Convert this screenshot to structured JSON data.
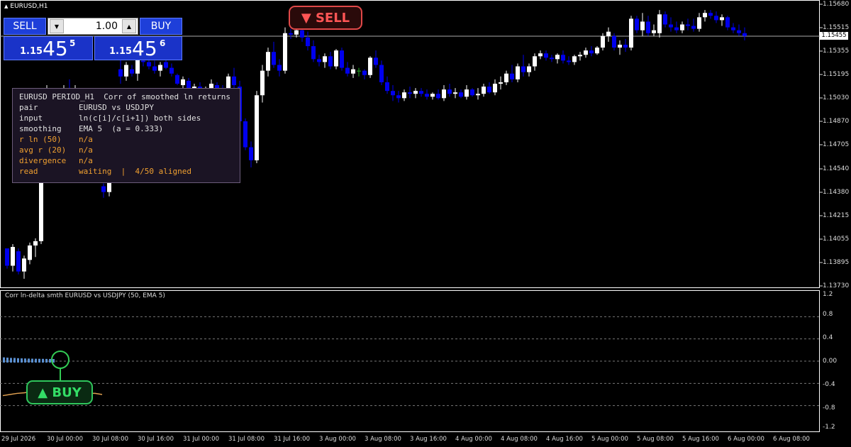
{
  "window": {
    "title": "EURUSD,H1"
  },
  "trade_panel": {
    "sell_label": "SELL",
    "buy_label": "BUY",
    "lot_value": "1.00",
    "bid": {
      "small": "1.15",
      "big": "45",
      "sup": "5"
    },
    "ask": {
      "small": "1.15",
      "big": "45",
      "sup": "6"
    }
  },
  "info_box": {
    "title": "EURUSD PERIOD_H1  Corr of smoothed ln returns",
    "rows": [
      {
        "label": "pair",
        "value": "EURUSD vs USDJPY",
        "tone": "w"
      },
      {
        "label": "input",
        "value": "ln(c[i]/c[i+1]) both sides",
        "tone": "w"
      },
      {
        "label": "smoothing",
        "value": "EMA 5  (a = 0.333)",
        "tone": "w"
      },
      {
        "label": "r ln (50)",
        "value": "n/a",
        "tone": "o"
      },
      {
        "label": "avg r (20)",
        "value": "n/a",
        "tone": "o"
      },
      {
        "label": "divergence",
        "value": "n/a",
        "tone": "o"
      },
      {
        "label": "read",
        "value": "waiting  |  4/50 aligned",
        "tone": "o"
      }
    ]
  },
  "signals": {
    "sell_label": "▼ SELL",
    "buy_label": "▲ BUY"
  },
  "subwindow": {
    "title": "Corr ln-delta smth EURUSD vs USDJPY (50, EMA 5)"
  },
  "price_axis": {
    "labels": [
      "1.15680",
      "1.15515",
      "1.15355",
      "1.15195",
      "1.15030",
      "1.14870",
      "1.14705",
      "1.14540",
      "1.14380",
      "1.14215",
      "1.14055",
      "1.13895",
      "1.13730"
    ],
    "current_price": "1.15455"
  },
  "sub_axis": {
    "labels": [
      "1.2",
      "0.8",
      "0.4",
      "0.00",
      "-0.4",
      "-0.8",
      "-1.2"
    ]
  },
  "time_axis": {
    "labels": [
      "29 Jul 2026",
      "30 Jul 00:00",
      "30 Jul 08:00",
      "30 Jul 16:00",
      "31 Jul 00:00",
      "31 Jul 08:00",
      "31 Jul 16:00",
      "3 Aug 00:00",
      "3 Aug 08:00",
      "3 Aug 16:00",
      "4 Aug 00:00",
      "4 Aug 08:00",
      "4 Aug 16:00",
      "5 Aug 00:00",
      "5 Aug 08:00",
      "5 Aug 16:00",
      "6 Aug 00:00",
      "6 Aug 08:00"
    ]
  },
  "colors": {
    "bull_candle": "#ffffff",
    "bear_candle": "#0000ee",
    "doji_candle": "#22aa22",
    "histogram": "#5a8fd0",
    "corr_line": "#e0a050",
    "buy_marker": "#33cc55"
  },
  "chart_data": {
    "type": "candlestick",
    "symbol": "EURUSD",
    "timeframe": "H1",
    "price_range": [
      1.1373,
      1.1568
    ],
    "candles": [
      [
        1.1399,
        1.1399,
        1.1385,
        1.1387
      ],
      [
        1.1387,
        1.1402,
        1.1383,
        1.14
      ],
      [
        1.1397,
        1.1399,
        1.1381,
        1.1383
      ],
      [
        1.1383,
        1.1394,
        1.1378,
        1.1392
      ],
      [
        1.1391,
        1.1403,
        1.1388,
        1.1401
      ],
      [
        1.1401,
        1.1406,
        1.1393,
        1.1404
      ],
      [
        1.1404,
        1.1474,
        1.1402,
        1.147
      ],
      [
        1.147,
        1.1512,
        1.1465,
        1.1505
      ],
      [
        1.1493,
        1.1506,
        1.149,
        1.1495
      ],
      [
        1.1495,
        1.15,
        1.1492,
        1.1498
      ],
      [
        1.1498,
        1.1512,
        1.1496,
        1.151
      ],
      [
        1.151,
        1.1516,
        1.1502,
        1.1505
      ],
      [
        1.1505,
        1.1512,
        1.15,
        1.1508
      ],
      [
        1.1503,
        1.1506,
        1.15,
        1.1501
      ],
      [
        1.1487,
        1.1488,
        1.1481,
        1.1482
      ],
      [
        1.1459,
        1.1461,
        1.1452,
        1.1453
      ],
      [
        1.1453,
        1.1461,
        1.1449,
        1.146
      ],
      [
        1.1442,
        1.1444,
        1.1434,
        1.1438
      ],
      [
        1.1438,
        1.146,
        1.1435,
        1.1456
      ],
      [
        1.1456,
        1.1508,
        1.1453,
        1.1505
      ],
      [
        1.1523,
        1.1534,
        1.1513,
        1.1518
      ],
      [
        1.1518,
        1.1528,
        1.1515,
        1.1526
      ],
      [
        1.1523,
        1.1526,
        1.1518,
        1.152
      ],
      [
        1.152,
        1.1531,
        1.1515,
        1.153
      ],
      [
        1.1529,
        1.1532,
        1.1525,
        1.1528
      ],
      [
        1.1528,
        1.1533,
        1.1523,
        1.1525
      ],
      [
        1.1525,
        1.1529,
        1.152,
        1.1522
      ],
      [
        1.1522,
        1.1528,
        1.1518,
        1.1526
      ],
      [
        1.1528,
        1.1531,
        1.1523,
        1.1524
      ],
      [
        1.1524,
        1.1527,
        1.1518,
        1.152
      ],
      [
        1.1519,
        1.152,
        1.1512,
        1.1513
      ],
      [
        1.1512,
        1.1518,
        1.1508,
        1.1516
      ],
      [
        1.1515,
        1.1517,
        1.1509,
        1.151
      ],
      [
        1.1509,
        1.1513,
        1.1504,
        1.1511
      ],
      [
        1.1511,
        1.1514,
        1.1505,
        1.1506
      ],
      [
        1.1506,
        1.1511,
        1.1501,
        1.1509
      ],
      [
        1.1508,
        1.1516,
        1.1505,
        1.1513
      ],
      [
        1.1512,
        1.1514,
        1.1504,
        1.1507
      ],
      [
        1.1508,
        1.1512,
        1.1495,
        1.1498
      ],
      [
        1.1498,
        1.152,
        1.1496,
        1.1518
      ],
      [
        1.1518,
        1.1524,
        1.151,
        1.1512
      ],
      [
        1.1511,
        1.1515,
        1.1485,
        1.1487
      ],
      [
        1.1487,
        1.1489,
        1.1467,
        1.1469
      ],
      [
        1.1469,
        1.1473,
        1.1455,
        1.146
      ],
      [
        1.146,
        1.1508,
        1.1458,
        1.1505
      ],
      [
        1.1505,
        1.1526,
        1.15,
        1.1522
      ],
      [
        1.1522,
        1.1538,
        1.1518,
        1.1535
      ],
      [
        1.1535,
        1.1542,
        1.1524,
        1.1526
      ],
      [
        1.1526,
        1.153,
        1.1518,
        1.1522
      ],
      [
        1.1522,
        1.1552,
        1.152,
        1.1548
      ],
      [
        1.1548,
        1.1551,
        1.1544,
        1.1547
      ],
      [
        1.1547,
        1.1553,
        1.1545,
        1.155
      ],
      [
        1.155,
        1.1554,
        1.1542,
        1.1545
      ],
      [
        1.1545,
        1.1549,
        1.1536,
        1.1539
      ],
      [
        1.1539,
        1.1543,
        1.1528,
        1.153
      ],
      [
        1.153,
        1.1533,
        1.1525,
        1.1528
      ],
      [
        1.1528,
        1.1534,
        1.1524,
        1.1532
      ],
      [
        1.1532,
        1.1535,
        1.1523,
        1.1525
      ],
      [
        1.1525,
        1.1537,
        1.1523,
        1.1536
      ],
      [
        1.1536,
        1.1538,
        1.1522,
        1.1524
      ],
      [
        1.1524,
        1.1528,
        1.1518,
        1.152
      ],
      [
        1.152,
        1.1526,
        1.1517,
        1.1523
      ],
      [
        1.1522,
        1.1524,
        1.1518,
        1.1522
      ],
      [
        1.1522,
        1.1523,
        1.1516,
        1.1519
      ],
      [
        1.1519,
        1.1532,
        1.1517,
        1.1531
      ],
      [
        1.1531,
        1.1536,
        1.1524,
        1.1526
      ],
      [
        1.1526,
        1.1529,
        1.1512,
        1.1514
      ],
      [
        1.1514,
        1.1518,
        1.1506,
        1.1508
      ],
      [
        1.1508,
        1.1512,
        1.1501,
        1.1505
      ],
      [
        1.1505,
        1.1508,
        1.15,
        1.1503
      ],
      [
        1.1503,
        1.1509,
        1.1501,
        1.1507
      ],
      [
        1.1507,
        1.1511,
        1.1503,
        1.1506
      ],
      [
        1.1506,
        1.151,
        1.1503,
        1.1508
      ],
      [
        1.1508,
        1.151,
        1.1504,
        1.1506
      ],
      [
        1.1506,
        1.1509,
        1.1502,
        1.1504
      ],
      [
        1.1504,
        1.1507,
        1.1502,
        1.1506
      ],
      [
        1.1506,
        1.1509,
        1.1502,
        1.1503
      ],
      [
        1.1503,
        1.1512,
        1.1501,
        1.1509
      ],
      [
        1.1509,
        1.1513,
        1.1504,
        1.1506
      ],
      [
        1.1506,
        1.151,
        1.1503,
        1.1507
      ],
      [
        1.1507,
        1.1509,
        1.1503,
        1.1504
      ],
      [
        1.1504,
        1.1512,
        1.1502,
        1.1509
      ],
      [
        1.1509,
        1.151,
        1.1504,
        1.1505
      ],
      [
        1.1505,
        1.151,
        1.1502,
        1.1506
      ],
      [
        1.1506,
        1.1513,
        1.1504,
        1.1511
      ],
      [
        1.1511,
        1.1514,
        1.1506,
        1.1507
      ],
      [
        1.1507,
        1.1516,
        1.1505,
        1.1513
      ],
      [
        1.1513,
        1.1518,
        1.1509,
        1.1514
      ],
      [
        1.1514,
        1.1522,
        1.1512,
        1.152
      ],
      [
        1.152,
        1.1526,
        1.1514,
        1.1516
      ],
      [
        1.1516,
        1.1527,
        1.1514,
        1.1525
      ],
      [
        1.1525,
        1.1533,
        1.1518,
        1.1521
      ],
      [
        1.1521,
        1.1527,
        1.1518,
        1.1525
      ],
      [
        1.1525,
        1.1534,
        1.1522,
        1.1532
      ],
      [
        1.1532,
        1.1536,
        1.153,
        1.1534
      ],
      [
        1.1534,
        1.1536,
        1.1529,
        1.1531
      ],
      [
        1.1531,
        1.1533,
        1.1528,
        1.153
      ],
      [
        1.153,
        1.1534,
        1.1527,
        1.1533
      ],
      [
        1.1533,
        1.1536,
        1.1527,
        1.1529
      ],
      [
        1.1529,
        1.1532,
        1.1526,
        1.1528
      ],
      [
        1.1528,
        1.1533,
        1.1526,
        1.1532
      ],
      [
        1.1532,
        1.1535,
        1.1529,
        1.1533
      ],
      [
        1.1533,
        1.1538,
        1.1531,
        1.1536
      ],
      [
        1.1536,
        1.1539,
        1.1532,
        1.1534
      ],
      [
        1.1534,
        1.1539,
        1.1533,
        1.1538
      ],
      [
        1.1538,
        1.1548,
        1.1536,
        1.1546
      ],
      [
        1.1546,
        1.1552,
        1.1542,
        1.1549
      ],
      [
        1.1546,
        1.1548,
        1.1536,
        1.1538
      ],
      [
        1.1538,
        1.1543,
        1.1533,
        1.154
      ],
      [
        1.154,
        1.1544,
        1.1535,
        1.1538
      ],
      [
        1.1538,
        1.156,
        1.1536,
        1.1558
      ],
      [
        1.1558,
        1.156,
        1.1548,
        1.155
      ],
      [
        1.155,
        1.1562,
        1.1546,
        1.1556
      ],
      [
        1.1556,
        1.156,
        1.1546,
        1.1548
      ],
      [
        1.1548,
        1.1554,
        1.1546,
        1.155
      ],
      [
        1.1548,
        1.1564,
        1.1545,
        1.1561
      ],
      [
        1.1561,
        1.1563,
        1.1552,
        1.1554
      ],
      [
        1.1554,
        1.1559,
        1.1549,
        1.1552
      ],
      [
        1.1552,
        1.1556,
        1.1548,
        1.155
      ],
      [
        1.155,
        1.1556,
        1.1548,
        1.1554
      ],
      [
        1.1554,
        1.1558,
        1.155,
        1.1553
      ],
      [
        1.1553,
        1.1558,
        1.1549,
        1.1551
      ],
      [
        1.1551,
        1.1562,
        1.1549,
        1.1559
      ],
      [
        1.1559,
        1.1564,
        1.1556,
        1.1562
      ],
      [
        1.1562,
        1.1564,
        1.1558,
        1.156
      ],
      [
        1.156,
        1.1563,
        1.1555,
        1.1557
      ],
      [
        1.1557,
        1.1561,
        1.1553,
        1.1559
      ],
      [
        1.1559,
        1.156,
        1.155,
        1.1552
      ],
      [
        1.1552,
        1.1555,
        1.1548,
        1.155
      ],
      [
        1.155,
        1.1554,
        1.1546,
        1.1548
      ],
      [
        1.1548,
        1.1552,
        1.1543,
        1.1546
      ]
    ],
    "indicator": {
      "name": "Corr ln-delta smth EURUSD vs USDJPY (50, EMA 5)",
      "ylim": [
        -1.2,
        1.2
      ],
      "levels": [
        0.8,
        0.4,
        0.0,
        -0.4,
        -0.8
      ],
      "histogram": [
        0.03,
        0.025,
        0.02,
        0.02,
        0.015,
        0.012,
        0.01,
        0.008,
        0.006,
        0.005,
        0.004,
        0.003,
        0.002,
        0.001,
        0.0
      ],
      "corr_line": [
        -0.62,
        -0.6,
        -0.58,
        -0.57,
        -0.55,
        -0.56,
        -0.57,
        -0.56,
        -0.55,
        -0.56,
        -0.57,
        -0.58,
        -0.58,
        -0.58,
        -0.6
      ]
    }
  }
}
